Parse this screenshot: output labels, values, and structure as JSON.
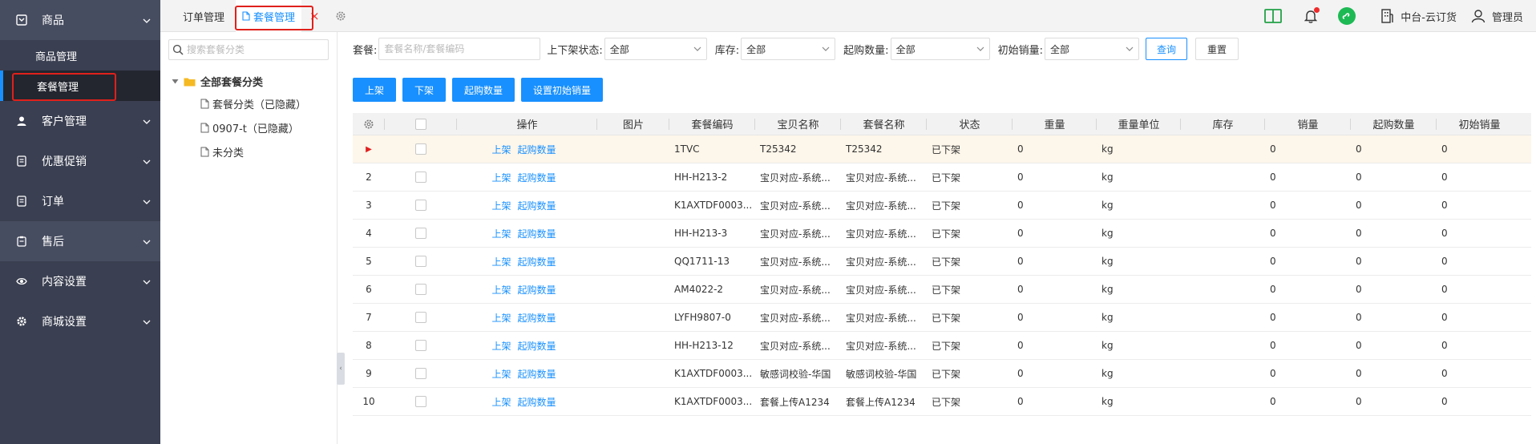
{
  "sidebar": {
    "groups": [
      {
        "label": "商品",
        "icon": "product-icon"
      },
      {
        "label": "客户管理",
        "icon": "user-icon"
      },
      {
        "label": "优惠促销",
        "icon": "promotion-icon"
      },
      {
        "label": "订单",
        "icon": "order-icon"
      },
      {
        "label": "售后",
        "icon": "aftersale-icon"
      },
      {
        "label": "内容设置",
        "icon": "eye-icon"
      },
      {
        "label": "商城设置",
        "icon": "gear-icon"
      }
    ],
    "sub_items": [
      {
        "label": "商品管理"
      },
      {
        "label": "套餐管理"
      }
    ]
  },
  "topbar": {
    "tabs": [
      {
        "label": "订单管理"
      },
      {
        "label": "套餐管理"
      }
    ],
    "close_glyph": "×",
    "store_name": "中台-云订货",
    "user_name": "管理员"
  },
  "tree": {
    "search_placeholder": "搜索套餐分类",
    "root_label": "全部套餐分类",
    "items": [
      {
        "label": "套餐分类（已隐藏）"
      },
      {
        "label": "0907-t（已隐藏）"
      },
      {
        "label": "未分类"
      }
    ]
  },
  "filters": {
    "package_label": "套餐:",
    "package_placeholder": "套餐名称/套餐编码",
    "status_label": "上下架状态:",
    "status_value": "全部",
    "stock_label": "库存:",
    "stock_value": "全部",
    "minqty_label": "起购数量:",
    "minqty_value": "全部",
    "initsales_label": "初始销量:",
    "initsales_value": "全部",
    "query_label": "查询",
    "reset_label": "重置"
  },
  "actions": {
    "on_shelf": "上架",
    "off_shelf": "下架",
    "min_qty": "起购数量",
    "set_initial_sales": "设置初始销量"
  },
  "table": {
    "headers": [
      "操作",
      "图片",
      "套餐编码",
      "宝贝名称",
      "套餐名称",
      "状态",
      "重量",
      "重量单位",
      "库存",
      "销量",
      "起购数量",
      "初始销量"
    ],
    "row_action_1": "上架",
    "row_action_2": "起购数量",
    "rows": [
      {
        "index": "",
        "code": "1TVC",
        "item_name": "T25342",
        "package_name": "T25342",
        "status": "已下架",
        "weight": "0",
        "unit": "kg",
        "stock": "",
        "sales": "0",
        "min_qty": "0",
        "init_sales": "0"
      },
      {
        "index": "2",
        "code": "HH-H213-2",
        "item_name": "宝贝对应-系统...",
        "package_name": "宝贝对应-系统...",
        "status": "已下架",
        "weight": "0",
        "unit": "kg",
        "stock": "",
        "sales": "0",
        "min_qty": "0",
        "init_sales": "0"
      },
      {
        "index": "3",
        "code": "K1AXTDF0003...",
        "item_name": "宝贝对应-系统...",
        "package_name": "宝贝对应-系统...",
        "status": "已下架",
        "weight": "0",
        "unit": "kg",
        "stock": "",
        "sales": "0",
        "min_qty": "0",
        "init_sales": "0"
      },
      {
        "index": "4",
        "code": "HH-H213-3",
        "item_name": "宝贝对应-系统...",
        "package_name": "宝贝对应-系统...",
        "status": "已下架",
        "weight": "0",
        "unit": "kg",
        "stock": "",
        "sales": "0",
        "min_qty": "0",
        "init_sales": "0"
      },
      {
        "index": "5",
        "code": "QQ1711-13",
        "item_name": "宝贝对应-系统...",
        "package_name": "宝贝对应-系统...",
        "status": "已下架",
        "weight": "0",
        "unit": "kg",
        "stock": "",
        "sales": "0",
        "min_qty": "0",
        "init_sales": "0"
      },
      {
        "index": "6",
        "code": "AM4022-2",
        "item_name": "宝贝对应-系统...",
        "package_name": "宝贝对应-系统...",
        "status": "已下架",
        "weight": "0",
        "unit": "kg",
        "stock": "",
        "sales": "0",
        "min_qty": "0",
        "init_sales": "0"
      },
      {
        "index": "7",
        "code": "LYFH9807-0",
        "item_name": "宝贝对应-系统...",
        "package_name": "宝贝对应-系统...",
        "status": "已下架",
        "weight": "0",
        "unit": "kg",
        "stock": "",
        "sales": "0",
        "min_qty": "0",
        "init_sales": "0"
      },
      {
        "index": "8",
        "code": "HH-H213-12",
        "item_name": "宝贝对应-系统...",
        "package_name": "宝贝对应-系统...",
        "status": "已下架",
        "weight": "0",
        "unit": "kg",
        "stock": "",
        "sales": "0",
        "min_qty": "0",
        "init_sales": "0"
      },
      {
        "index": "9",
        "code": "K1AXTDF0003...",
        "item_name": "敏感词校验-华国",
        "package_name": "敏感词校验-华国",
        "status": "已下架",
        "weight": "0",
        "unit": "kg",
        "stock": "",
        "sales": "0",
        "min_qty": "0",
        "init_sales": "0"
      },
      {
        "index": "10",
        "code": "K1AXTDF0003...",
        "item_name": "套餐上传A1234",
        "package_name": "套餐上传A1234",
        "status": "已下架",
        "weight": "0",
        "unit": "kg",
        "stock": "",
        "sales": "0",
        "min_qty": "0",
        "init_sales": "0"
      }
    ]
  },
  "colors": {
    "sidebar_bg": "#3a3f51",
    "accent": "#1890ff",
    "highlight_red": "#e0201b",
    "current_row_bg": "#fdf6ea"
  }
}
